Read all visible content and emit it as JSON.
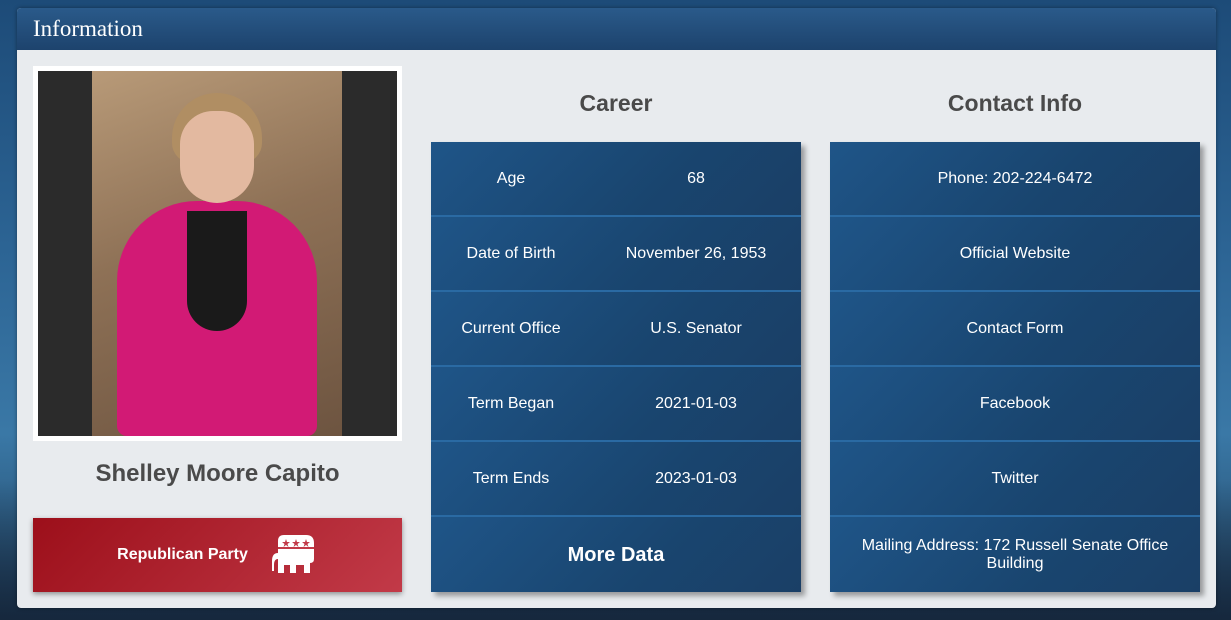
{
  "panel": {
    "title": "Information"
  },
  "profile": {
    "name": "Shelley Moore Capito",
    "party_label": "Republican Party",
    "party_icon": "elephant-icon"
  },
  "career": {
    "title": "Career",
    "rows": [
      {
        "label": "Age",
        "value": "68"
      },
      {
        "label": "Date of Birth",
        "value": "November 26, 1953"
      },
      {
        "label": "Current Office",
        "value": "U.S. Senator"
      },
      {
        "label": "Term Began",
        "value": "2021-01-03"
      },
      {
        "label": "Term Ends",
        "value": "2023-01-03"
      }
    ],
    "more_label": "More Data"
  },
  "contact": {
    "title": "Contact Info",
    "phone": "Phone: 202-224-6472",
    "website": "Official Website",
    "form": "Contact Form",
    "facebook": "Facebook",
    "twitter": "Twitter",
    "mailing": "Mailing Address: 172 Russell Senate Office Building"
  },
  "colors": {
    "header": "#1d436d",
    "tile": "#19456f",
    "party": "#9c0f1a"
  }
}
